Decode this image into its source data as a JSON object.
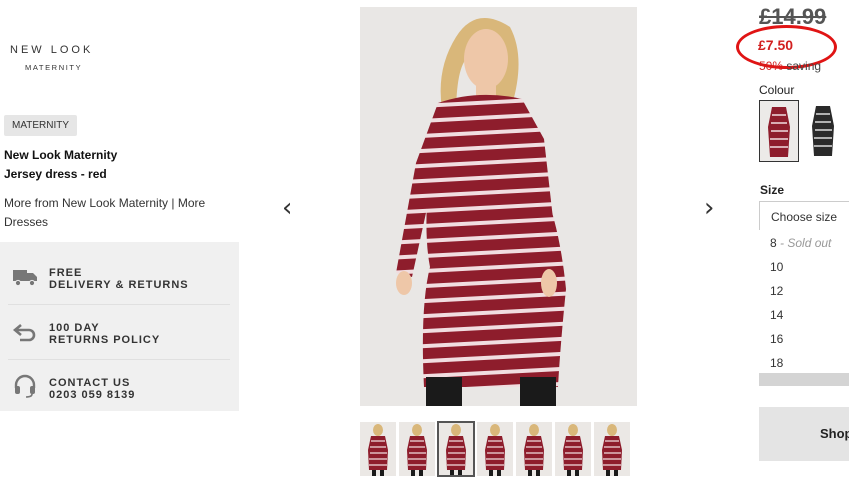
{
  "brand": {
    "name": "NEW LOOK",
    "sub": "MATERNITY"
  },
  "tag": "MATERNITY",
  "product": {
    "name_line1": "New Look Maternity",
    "name_line2": "Jersey dress - red"
  },
  "more_from": "More from New Look Maternity | More Dresses",
  "info": [
    {
      "icon": "truck-icon",
      "line1": "FREE",
      "line2": "DELIVERY & RETURNS"
    },
    {
      "icon": "return-arrow-icon",
      "line1": "100 DAY",
      "line2": "RETURNS POLICY"
    },
    {
      "icon": "headset-icon",
      "line1": "CONTACT US",
      "line2": "0203 059 8139"
    }
  ],
  "gallery": {
    "prev": "‹",
    "next": "›",
    "thumb_count": 7,
    "selected_thumb": 2
  },
  "price": {
    "old": "£14.99",
    "new": "£7.50",
    "saving_pct": "50%",
    "saving_text": " saving"
  },
  "colour": {
    "label": "Colour",
    "options": [
      "red stripe",
      "black stripe"
    ],
    "selected": 0
  },
  "size": {
    "label": "Size",
    "placeholder": "Choose size",
    "options": [
      {
        "size": "8",
        "note": " - Sold out"
      },
      {
        "size": "10",
        "note": ""
      },
      {
        "size": "12",
        "note": ""
      },
      {
        "size": "14",
        "note": ""
      },
      {
        "size": "16",
        "note": ""
      },
      {
        "size": "18",
        "note": ""
      }
    ]
  },
  "shop_button": "Shop",
  "colors": {
    "accent_red": "#d21f1f",
    "dress": "#8e1d2c",
    "stripe": "#f1dde0"
  }
}
